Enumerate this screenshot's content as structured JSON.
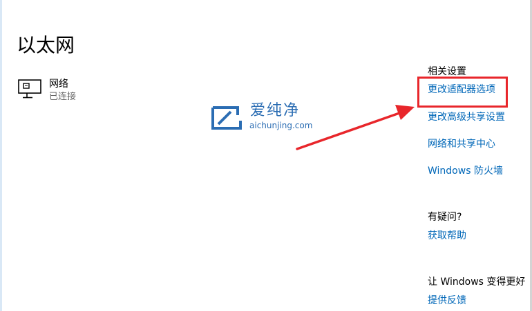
{
  "page": {
    "title": "以太网"
  },
  "network": {
    "name": "网络",
    "status": "已连接",
    "icon": "ethernet-monitor-icon"
  },
  "related_settings": {
    "heading": "相关设置",
    "links": [
      "更改适配器选项",
      "更改高级共享设置",
      "网络和共享中心",
      "Windows 防火墙"
    ]
  },
  "help": {
    "heading": "有疑问?",
    "link": "获取帮助"
  },
  "feedback": {
    "heading": "让 Windows 变得更好",
    "link": "提供反馈"
  },
  "watermark": {
    "text": "爱纯净",
    "url": "aichunjing.com"
  },
  "colors": {
    "link": "#0067b8",
    "highlight": "#e8262b",
    "watermark": "#2b6db3"
  }
}
